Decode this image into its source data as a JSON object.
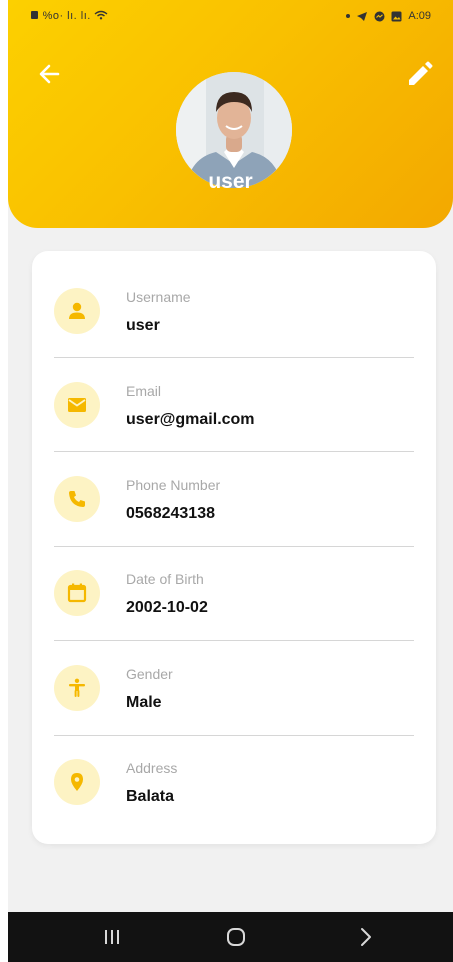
{
  "status_bar": {
    "left_text": "%o· lı. lı.",
    "time": "A:09"
  },
  "header": {
    "user_display_name": "user",
    "accent_color": "#f9c000",
    "back_icon": "arrow-left-icon",
    "edit_icon": "pencil-icon"
  },
  "profile": {
    "fields": [
      {
        "label": "Username",
        "value": "user",
        "icon": "person-icon"
      },
      {
        "label": "Email",
        "value": "user@gmail.com",
        "icon": "envelope-icon"
      },
      {
        "label": "Phone Number",
        "value": "0568243138",
        "icon": "phone-icon"
      },
      {
        "label": "Date of Birth",
        "value": "2002-10-02",
        "icon": "calendar-icon"
      },
      {
        "label": "Gender",
        "value": "Male",
        "icon": "accessibility-icon"
      },
      {
        "label": "Address",
        "value": "Balata",
        "icon": "location-pin-icon"
      }
    ],
    "icon_color": "#f5b800",
    "icon_bg_color": "#fdf3c4"
  },
  "nav_bar": {
    "buttons": [
      "recent-apps",
      "home",
      "back"
    ]
  }
}
